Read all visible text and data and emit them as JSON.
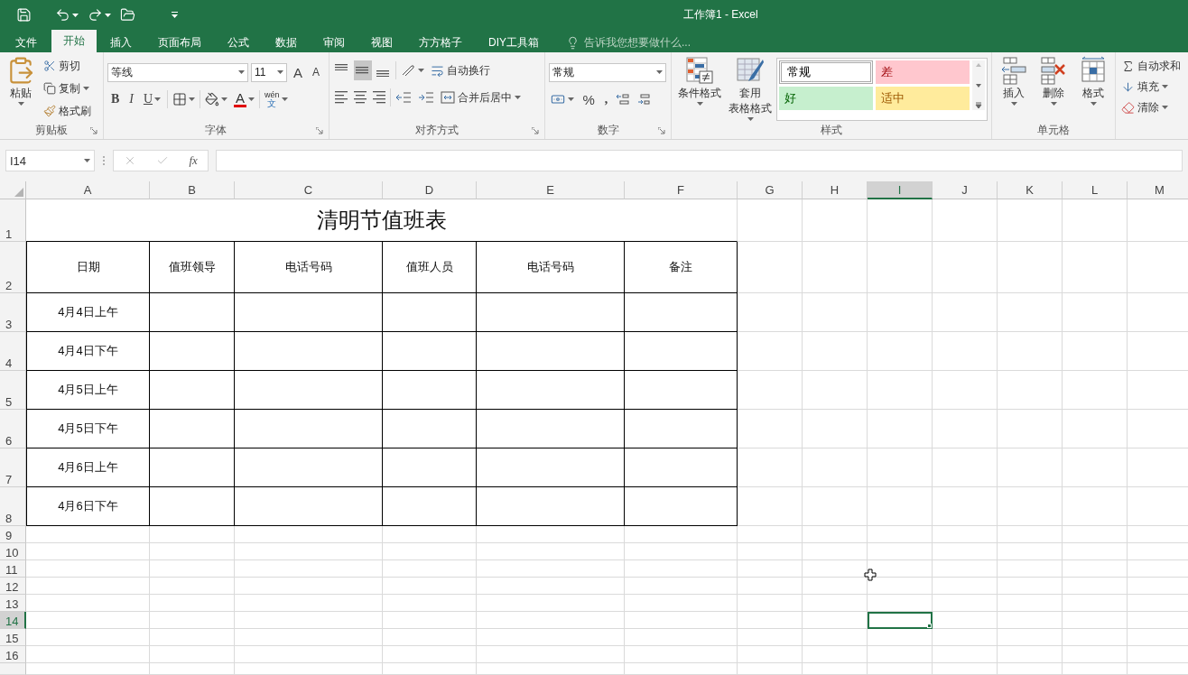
{
  "title_bar": {
    "title": "工作簿1 - Excel"
  },
  "menu_tabs": [
    {
      "label": "文件",
      "selected": false
    },
    {
      "label": "开始",
      "selected": true
    },
    {
      "label": "插入",
      "selected": false
    },
    {
      "label": "页面布局",
      "selected": false
    },
    {
      "label": "公式",
      "selected": false
    },
    {
      "label": "数据",
      "selected": false
    },
    {
      "label": "审阅",
      "selected": false
    },
    {
      "label": "视图",
      "selected": false
    },
    {
      "label": "方方格子",
      "selected": false
    },
    {
      "label": "DIY工具箱",
      "selected": false
    }
  ],
  "tell_me": {
    "placeholder": "告诉我您想要做什么..."
  },
  "ribbon": {
    "clipboard": {
      "label": "剪贴板",
      "paste": "粘贴",
      "cut": "剪切",
      "copy": "复制",
      "format_painter": "格式刷"
    },
    "font": {
      "label": "字体",
      "font_name": "等线",
      "font_size": "11",
      "grow": "A",
      "shrink": "A",
      "bold": "B",
      "italic": "I",
      "underline": "U",
      "font_color": "A",
      "phonetic_pinyin": "wén",
      "phonetic_char": "文"
    },
    "alignment": {
      "label": "对齐方式",
      "wrap_text": "自动换行",
      "merge_center": "合并后居中",
      "vertical_align": [
        {
          "kind": "top",
          "selected": false
        },
        {
          "kind": "middle",
          "selected": true
        },
        {
          "kind": "bottom",
          "selected": false
        }
      ]
    },
    "number": {
      "label": "数字",
      "format": "常规",
      "percent": "%",
      "comma": ","
    },
    "styles": {
      "label": "样式",
      "conditional_formatting": "条件格式",
      "format_as_table": [
        "套用",
        "表格格式"
      ],
      "cell_styles": [
        {
          "label": "常规",
          "kind": "normal",
          "color": "#ffffff",
          "selected": true
        },
        {
          "label": "差",
          "kind": "bad",
          "color": "#ffc7ce",
          "selected": false
        },
        {
          "label": "好",
          "kind": "good",
          "color": "#c6efce",
          "selected": false
        },
        {
          "label": "适中",
          "kind": "neutral",
          "color": "#ffeb9c",
          "selected": false
        }
      ]
    },
    "cells": {
      "label": "单元格",
      "insert": "插入",
      "delete": "删除",
      "format": "格式"
    },
    "editing": {
      "autosum": "自动求和",
      "fill": "填充",
      "clear": "清除"
    }
  },
  "formula_bar": {
    "name_box": "I14",
    "function_label": "fx"
  },
  "sheet": {
    "columns": [
      {
        "label": "A",
        "selected": false
      },
      {
        "label": "B",
        "selected": false
      },
      {
        "label": "C",
        "selected": false
      },
      {
        "label": "D",
        "selected": false
      },
      {
        "label": "E",
        "selected": false
      },
      {
        "label": "F",
        "selected": false
      },
      {
        "label": "G",
        "selected": false
      },
      {
        "label": "H",
        "selected": false
      },
      {
        "label": "I",
        "selected": true
      },
      {
        "label": "J",
        "selected": false
      },
      {
        "label": "K",
        "selected": false
      },
      {
        "label": "L",
        "selected": false
      },
      {
        "label": "M",
        "selected": false
      }
    ],
    "rows": [
      {
        "label": "1",
        "selected": false
      },
      {
        "label": "2",
        "selected": false
      },
      {
        "label": "3",
        "selected": false
      },
      {
        "label": "4",
        "selected": false
      },
      {
        "label": "5",
        "selected": false
      },
      {
        "label": "6",
        "selected": false
      },
      {
        "label": "7",
        "selected": false
      },
      {
        "label": "8",
        "selected": false
      },
      {
        "label": "9",
        "selected": false
      },
      {
        "label": "10",
        "selected": false
      },
      {
        "label": "11",
        "selected": false
      },
      {
        "label": "12",
        "selected": false
      },
      {
        "label": "13",
        "selected": false
      },
      {
        "label": "14",
        "selected": true
      },
      {
        "label": "15",
        "selected": false
      },
      {
        "label": "16",
        "selected": false
      }
    ],
    "title": "清明节值班表",
    "headers": [
      "日期",
      "值班领导",
      "电话号码",
      "值班人员",
      "电话号码",
      "备注"
    ],
    "dates": [
      "4月4日上午",
      "4月4日下午",
      "4月5日上午",
      "4月5日下午",
      "4月6日上午",
      "4月6日下午"
    ]
  }
}
